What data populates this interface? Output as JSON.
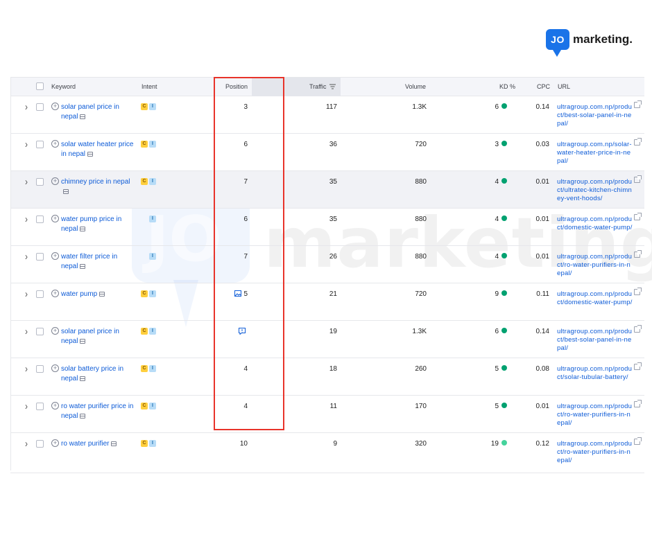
{
  "logo": {
    "badge": "JO",
    "text": "marketing."
  },
  "watermark": {
    "badge": "JO",
    "text": "marketing."
  },
  "headers": {
    "keyword": "Keyword",
    "intent": "Intent",
    "position": "Position",
    "traffic": "Traffic",
    "volume": "Volume",
    "kd": "KD %",
    "cpc": "CPC",
    "url": "URL"
  },
  "colors": {
    "link": "#0d5bd7",
    "kd_dark": "#00a170",
    "kd_light": "#45d39c",
    "highlight": "#e8332a",
    "intent_commercial": "#ffcf3e",
    "intent_informational": "#b7dcf7"
  },
  "rows": [
    {
      "keyword": "solar panel price in nepal",
      "intent": [
        "C",
        "I"
      ],
      "position": "3",
      "serp_feature": "",
      "traffic": "117",
      "volume": "1.3K",
      "kd": "6",
      "cpc": "0.14",
      "url": "ultragroup.com.np/product/best-solar-panel-in-nepal/"
    },
    {
      "keyword": "solar water heater price in nepal",
      "intent": [
        "C",
        "I"
      ],
      "position": "6",
      "serp_feature": "",
      "traffic": "36",
      "volume": "720",
      "kd": "3",
      "cpc": "0.03",
      "url": "ultragroup.com.np/solar-water-heater-price-in-nepal/"
    },
    {
      "keyword": "chimney price in nepal",
      "intent": [
        "C",
        "I"
      ],
      "position": "7",
      "serp_feature": "",
      "traffic": "35",
      "volume": "880",
      "kd": "4",
      "cpc": "0.01",
      "url": "ultragroup.com.np/product/ultratec-kitchen-chimney-vent-hoods/"
    },
    {
      "keyword": "water pump price in nepal",
      "intent": [
        "I"
      ],
      "position": "6",
      "serp_feature": "",
      "traffic": "35",
      "volume": "880",
      "kd": "4",
      "cpc": "0.01",
      "url": "ultragroup.com.np/product/domestic-water-pump/"
    },
    {
      "keyword": "water filter price in nepal",
      "intent": [
        "I"
      ],
      "position": "7",
      "serp_feature": "",
      "traffic": "26",
      "volume": "880",
      "kd": "4",
      "cpc": "0.01",
      "url": "ultragroup.com.np/product/ro-water-purifiers-in-nepal/"
    },
    {
      "keyword": "water pump",
      "intent": [
        "C",
        "I"
      ],
      "position": "5",
      "serp_feature": "image-icon",
      "traffic": "21",
      "volume": "720",
      "kd": "9",
      "cpc": "0.11",
      "url": "ultragroup.com.np/product/domestic-water-pump/"
    },
    {
      "keyword": "solar panel price in nepal",
      "intent": [
        "C",
        "I"
      ],
      "position": "",
      "serp_feature": "review-icon",
      "traffic": "19",
      "volume": "1.3K",
      "kd": "6",
      "cpc": "0.14",
      "url": "ultragroup.com.np/product/best-solar-panel-in-nepal/"
    },
    {
      "keyword": "solar battery price in nepal",
      "intent": [
        "C",
        "I"
      ],
      "position": "4",
      "serp_feature": "",
      "traffic": "18",
      "volume": "260",
      "kd": "5",
      "cpc": "0.08",
      "url": "ultragroup.com.np/product/solar-tubular-battery/"
    },
    {
      "keyword": "ro water purifier price in nepal",
      "intent": [
        "C",
        "I"
      ],
      "position": "4",
      "serp_feature": "",
      "traffic": "11",
      "volume": "170",
      "kd": "5",
      "cpc": "0.01",
      "url": "ultragroup.com.np/product/ro-water-purifiers-in-nepal/"
    },
    {
      "keyword": "ro water purifier",
      "intent": [
        "C",
        "I"
      ],
      "position": "10",
      "serp_feature": "",
      "traffic": "9",
      "volume": "320",
      "kd": "19",
      "cpc": "0.12",
      "url": "ultragroup.com.np/product/ro-water-purifiers-in-nepal/"
    }
  ]
}
